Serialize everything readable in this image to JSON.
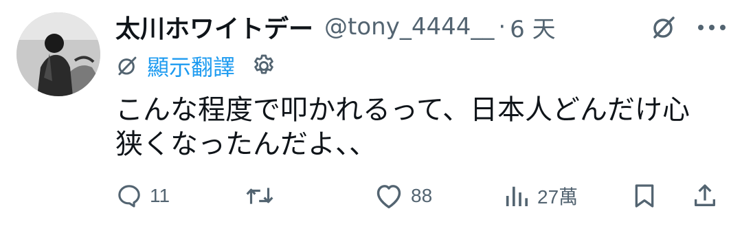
{
  "user": {
    "display_name": "太川ホワイトデー",
    "handle": "@tony_4444__",
    "separator": "·",
    "time": "6 天"
  },
  "translate": {
    "label": "顯示翻譯"
  },
  "tweet": {
    "lines": [
      "こんな程度で叩かれるって、日本人どんだけ心",
      "狭くなったんだよ、、"
    ]
  },
  "actions": {
    "replies": "11",
    "reposts": "",
    "likes": "88",
    "views": "27萬"
  },
  "icons": {
    "grok": "grok-icon",
    "more": "more-dots-icon",
    "translate": "translate-icon",
    "settings": "gear-icon",
    "reply": "reply-icon",
    "repost": "repost-icon",
    "like": "heart-icon",
    "views": "views-icon",
    "bookmark": "bookmark-icon",
    "share": "share-icon"
  },
  "colors": {
    "link": "#1d9bf0",
    "muted": "#536471",
    "text": "#0f1419"
  }
}
